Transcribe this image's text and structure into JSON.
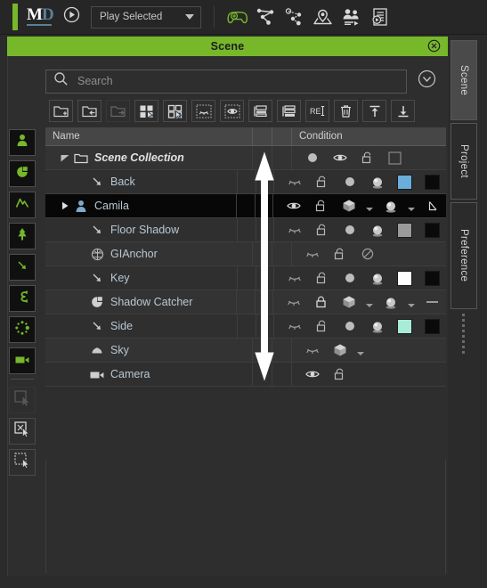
{
  "app": {
    "logo_primary": "M",
    "logo_secondary": "D"
  },
  "toolbar": {
    "play_button": "play-icon",
    "mode_select": {
      "value": "Play Selected",
      "caret": "chevron-down-icon"
    },
    "icons": [
      {
        "name": "gamepad-add-icon",
        "color": "#76b82a"
      },
      {
        "name": "motion-path-icon",
        "color": "#d8d8d8"
      },
      {
        "name": "motion-path-record-icon",
        "color": "#d8d8d8"
      },
      {
        "name": "stage-pin-icon",
        "color": "#d8d8d8"
      },
      {
        "name": "crowd-people-icon",
        "color": "#d8d8d8"
      },
      {
        "name": "script-play-icon",
        "color": "#d8d8d8"
      }
    ]
  },
  "scene_panel": {
    "title": "Scene",
    "close_icon": "close-circle-icon",
    "search": {
      "placeholder": "Search",
      "value": "",
      "icon": "search-icon",
      "expand_icon": "chevron-down-circle-icon"
    },
    "tool_buttons": [
      {
        "name": "new-folder-button",
        "icon": "folder-plus-icon",
        "enabled": true
      },
      {
        "name": "move-into-folder-button",
        "icon": "folder-in-icon",
        "enabled": true
      },
      {
        "name": "move-out-folder-button",
        "icon": "folder-out-icon",
        "enabled": false
      },
      {
        "name": "select-all-button",
        "icon": "select-all-icon",
        "enabled": true
      },
      {
        "name": "select-none-button",
        "icon": "select-none-icon",
        "enabled": true
      },
      {
        "name": "isolate-hide-button",
        "icon": "hide-selection-icon",
        "enabled": true
      },
      {
        "name": "isolate-show-button",
        "icon": "show-selection-icon",
        "enabled": true
      },
      {
        "name": "group-layers-button",
        "icon": "layers-group-icon",
        "enabled": true
      },
      {
        "name": "stack-layers-button",
        "icon": "layers-stack-icon",
        "enabled": true
      },
      {
        "name": "rename-button",
        "icon": "rename-text-icon",
        "enabled": true
      },
      {
        "name": "delete-button",
        "icon": "trash-icon",
        "enabled": true
      },
      {
        "name": "move-up-button",
        "icon": "arrow-up-bar-icon",
        "enabled": true
      },
      {
        "name": "move-down-button",
        "icon": "arrow-down-bar-icon",
        "enabled": true
      }
    ],
    "columns": {
      "name": "Name",
      "spacer1": "",
      "spacer2": "",
      "condition": "Condition"
    },
    "rows": [
      {
        "label": "Scene Collection",
        "type": "collection",
        "icon": "folder-icon",
        "indent": 0,
        "expander": "triangle-down",
        "selected": false,
        "condition": [
          {
            "kind": "icon",
            "name": "sphere-dot-icon"
          },
          {
            "kind": "icon",
            "name": "eye-open-icon"
          },
          {
            "kind": "icon",
            "name": "lock-open-icon"
          },
          {
            "kind": "checkbox",
            "name": "empty-checkbox"
          }
        ]
      },
      {
        "label": "Back",
        "type": "light",
        "icon": "spot-light-icon",
        "indent": 1,
        "expander": "",
        "selected": false,
        "condition": [
          {
            "kind": "icon",
            "name": "eye-closed-icon"
          },
          {
            "kind": "icon",
            "name": "lock-open-icon"
          },
          {
            "kind": "icon",
            "name": "sphere-dot-icon"
          },
          {
            "kind": "icon",
            "name": "material-ball-icon"
          },
          {
            "kind": "swatch",
            "name": "color-swatch",
            "color": "#6aaedb"
          },
          {
            "kind": "swatch",
            "name": "color-swatch",
            "color": "#0a0a0a"
          }
        ]
      },
      {
        "label": "Camila",
        "type": "character",
        "icon": "person-icon",
        "indent": 0,
        "expander": "triangle-right",
        "selected": true,
        "condition": [
          {
            "kind": "icon",
            "name": "eye-open-icon"
          },
          {
            "kind": "icon",
            "name": "lock-open-icon"
          },
          {
            "kind": "icon",
            "name": "cube-icon"
          },
          {
            "kind": "caret",
            "name": "dropdown-caret"
          },
          {
            "kind": "icon",
            "name": "material-ball-icon"
          },
          {
            "kind": "caret",
            "name": "dropdown-caret"
          },
          {
            "kind": "icon",
            "name": "corner-flag-icon"
          }
        ]
      },
      {
        "label": "Floor Shadow",
        "type": "light",
        "icon": "spot-light-icon",
        "indent": 1,
        "expander": "",
        "selected": false,
        "condition": [
          {
            "kind": "icon",
            "name": "eye-closed-icon"
          },
          {
            "kind": "icon",
            "name": "lock-open-icon"
          },
          {
            "kind": "icon",
            "name": "sphere-dot-icon"
          },
          {
            "kind": "icon",
            "name": "material-ball-icon"
          },
          {
            "kind": "swatch",
            "name": "color-swatch",
            "color": "#9a9a9a"
          },
          {
            "kind": "swatch",
            "name": "color-swatch",
            "color": "#0a0a0a"
          }
        ]
      },
      {
        "label": "GIAnchor",
        "type": "anchor",
        "icon": "globe-cube-icon",
        "indent": 1,
        "expander": "",
        "selected": false,
        "condition": [
          {
            "kind": "icon",
            "name": "eye-closed-icon"
          },
          {
            "kind": "icon",
            "name": "lock-open-icon"
          },
          {
            "kind": "icon",
            "name": "no-entry-icon"
          }
        ]
      },
      {
        "label": "Key",
        "type": "light",
        "icon": "spot-light-icon",
        "indent": 1,
        "expander": "",
        "selected": false,
        "condition": [
          {
            "kind": "icon",
            "name": "eye-closed-icon"
          },
          {
            "kind": "icon",
            "name": "lock-open-icon"
          },
          {
            "kind": "icon",
            "name": "sphere-dot-icon"
          },
          {
            "kind": "icon",
            "name": "material-ball-icon"
          },
          {
            "kind": "swatch",
            "name": "color-swatch",
            "color": "#ffffff"
          },
          {
            "kind": "swatch",
            "name": "color-swatch",
            "color": "#0a0a0a"
          }
        ]
      },
      {
        "label": "Shadow Catcher",
        "type": "prop",
        "icon": "pie-slice-icon",
        "indent": 1,
        "expander": "",
        "selected": false,
        "condition": [
          {
            "kind": "icon",
            "name": "eye-closed-icon"
          },
          {
            "kind": "icon",
            "name": "lock-closed-icon"
          },
          {
            "kind": "icon",
            "name": "cube-icon"
          },
          {
            "kind": "caret",
            "name": "dropdown-caret"
          },
          {
            "kind": "icon",
            "name": "material-ball-icon"
          },
          {
            "kind": "caret",
            "name": "dropdown-caret"
          },
          {
            "kind": "dash",
            "name": "dash-placeholder"
          }
        ]
      },
      {
        "label": "Side",
        "type": "light",
        "icon": "spot-light-icon",
        "indent": 1,
        "expander": "",
        "selected": false,
        "condition": [
          {
            "kind": "icon",
            "name": "eye-closed-icon"
          },
          {
            "kind": "icon",
            "name": "lock-open-icon"
          },
          {
            "kind": "icon",
            "name": "sphere-dot-icon"
          },
          {
            "kind": "icon",
            "name": "material-ball-icon"
          },
          {
            "kind": "swatch",
            "name": "color-swatch",
            "color": "#a8ecd8"
          },
          {
            "kind": "swatch",
            "name": "color-swatch",
            "color": "#0a0a0a"
          }
        ]
      },
      {
        "label": "Sky",
        "type": "sky",
        "icon": "cloud-icon",
        "indent": 1,
        "expander": "",
        "selected": false,
        "condition": [
          {
            "kind": "icon",
            "name": "eye-closed-icon"
          },
          {
            "kind": "icon",
            "name": "cube-icon"
          },
          {
            "kind": "caret",
            "name": "dropdown-caret"
          }
        ]
      },
      {
        "label": "Camera",
        "type": "camera",
        "icon": "video-camera-icon",
        "indent": 1,
        "expander": "",
        "selected": false,
        "condition": [
          {
            "kind": "icon",
            "name": "eye-open-icon"
          },
          {
            "kind": "icon",
            "name": "lock-open-icon"
          }
        ]
      }
    ]
  },
  "left_rail": {
    "tools": [
      {
        "name": "actor-tool",
        "icon": "person-icon",
        "state": "active"
      },
      {
        "name": "prop-tool",
        "icon": "pie-slice-icon",
        "state": "active"
      },
      {
        "name": "terrain-tool",
        "icon": "mountain-icon",
        "state": "active"
      },
      {
        "name": "vegetation-tool",
        "icon": "tree-icon",
        "state": "active"
      },
      {
        "name": "light-tool",
        "icon": "spot-light-icon",
        "state": "active"
      },
      {
        "name": "path-tool",
        "icon": "s-curve-icon",
        "state": "active"
      },
      {
        "name": "particle-tool",
        "icon": "particles-icon",
        "state": "active"
      },
      {
        "name": "camera-tool",
        "icon": "video-camera-icon",
        "state": "active"
      },
      {
        "name": "marquee-select-tool",
        "icon": "marquee-cursor-icon",
        "state": "disabled"
      },
      {
        "name": "deselect-tool",
        "icon": "marquee-deselect-cursor-icon",
        "state": "enabled"
      },
      {
        "name": "lasso-select-tool",
        "icon": "dotted-marquee-cursor-icon",
        "state": "enabled"
      }
    ]
  },
  "right_tabs": [
    {
      "name": "tab-scene",
      "label": "Scene",
      "active": true
    },
    {
      "name": "tab-project",
      "label": "Project",
      "active": false
    },
    {
      "name": "tab-preference",
      "label": "Preference",
      "active": false
    }
  ],
  "annotation": {
    "name": "vertical-double-arrow",
    "color": "#ffffff",
    "direction": "both"
  },
  "colors": {
    "accent_green": "#76b82a",
    "panel_bg": "#2e2e2e",
    "row_bg": "#333333",
    "selected_row_bg": "#070707",
    "header_bg": "#464646",
    "text": "#b9c8d4"
  }
}
